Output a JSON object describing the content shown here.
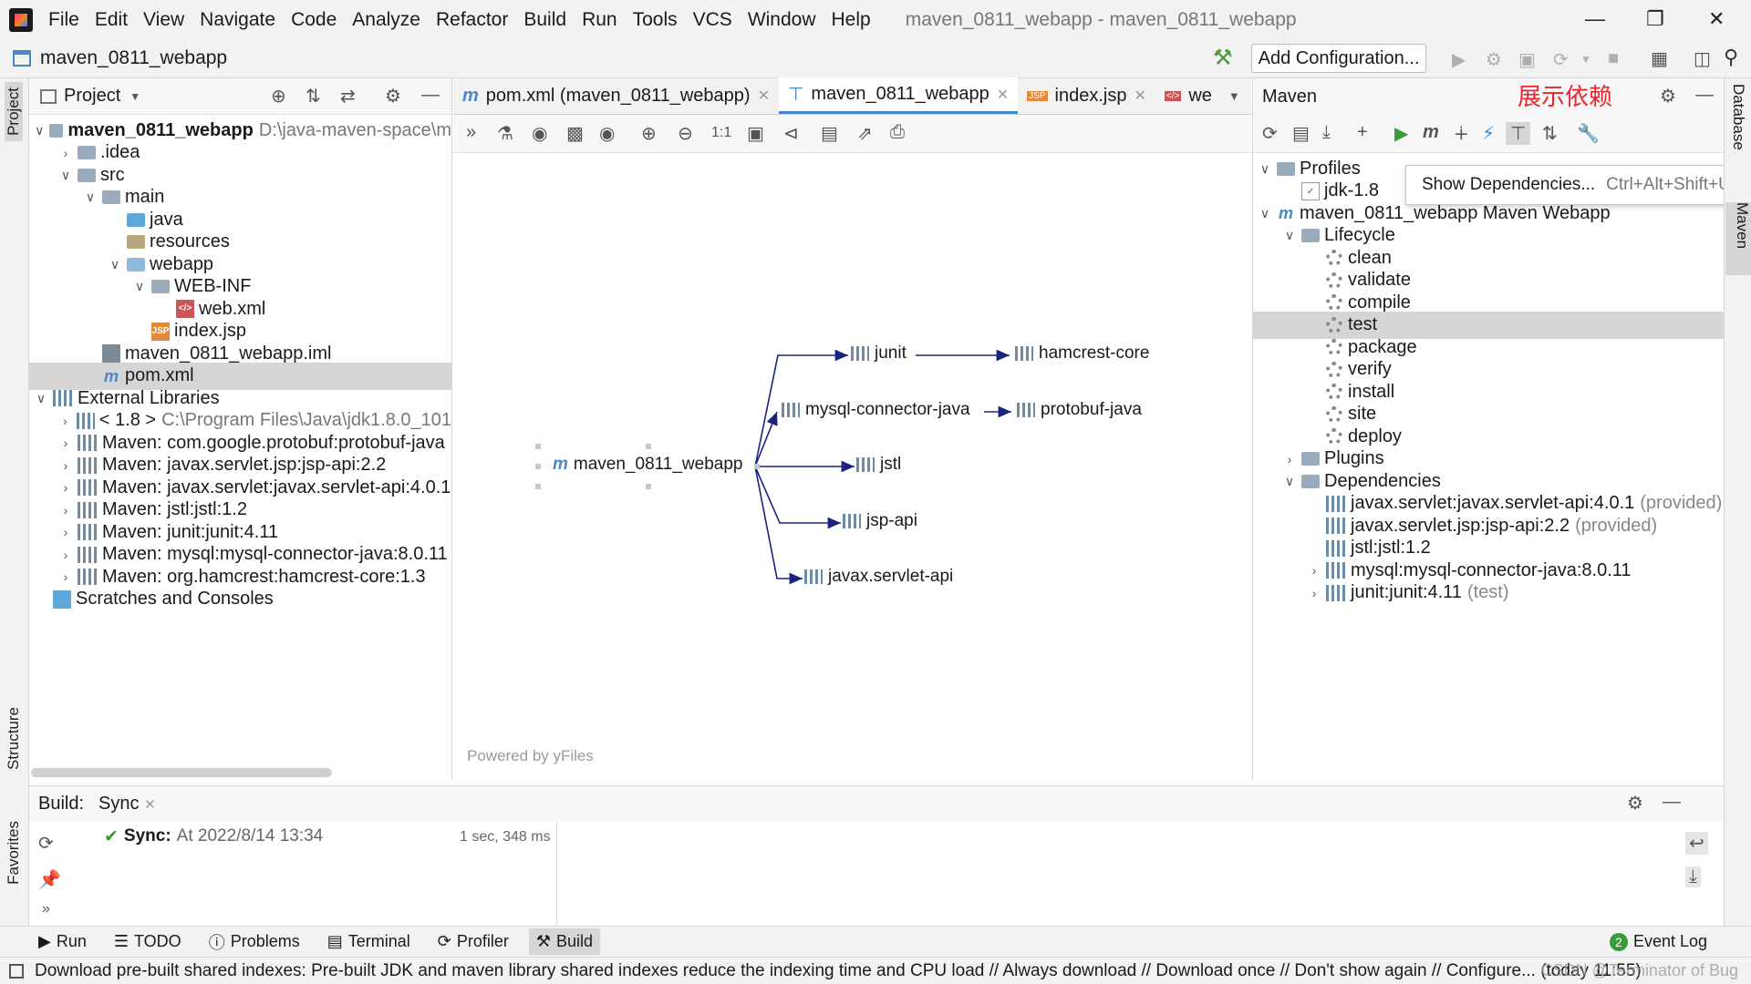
{
  "menu": {
    "items": [
      "File",
      "Edit",
      "View",
      "Navigate",
      "Code",
      "Analyze",
      "Refactor",
      "Build",
      "Run",
      "Tools",
      "VCS",
      "Window",
      "Help"
    ],
    "title": "maven_0811_webapp - maven_0811_webapp"
  },
  "nav": {
    "project": "maven_0811_webapp",
    "add_config": "Add Configuration..."
  },
  "stripe": {
    "project": "Project",
    "structure": "Structure",
    "favorites": "Favorites",
    "database": "Database",
    "maven": "Maven"
  },
  "project": {
    "title": "Project",
    "tree": [
      {
        "label": "maven_0811_webapp",
        "extra": "D:\\java-maven-space\\m",
        "level": 0,
        "arrow": "v",
        "icon": "module-folder",
        "bold": true
      },
      {
        "label": ".idea",
        "level": 1,
        "arrow": ">",
        "icon": "folder"
      },
      {
        "label": "src",
        "level": 1,
        "arrow": "v",
        "icon": "folder"
      },
      {
        "label": "main",
        "level": 2,
        "arrow": "v",
        "icon": "folder"
      },
      {
        "label": "java",
        "level": 3,
        "arrow": "",
        "icon": "source-folder"
      },
      {
        "label": "resources",
        "level": 3,
        "arrow": "",
        "icon": "resources-folder"
      },
      {
        "label": "webapp",
        "level": 3,
        "arrow": "v",
        "icon": "web-folder"
      },
      {
        "label": "WEB-INF",
        "level": 4,
        "arrow": "v",
        "icon": "folder"
      },
      {
        "label": "web.xml",
        "level": 5,
        "arrow": "",
        "icon": "xml-file"
      },
      {
        "label": "index.jsp",
        "level": 4,
        "arrow": "",
        "icon": "jsp-file"
      },
      {
        "label": "maven_0811_webapp.iml",
        "level": 2,
        "arrow": "",
        "icon": "iml-file"
      },
      {
        "label": "pom.xml",
        "level": 2,
        "arrow": "",
        "icon": "maven-file",
        "selected": true
      },
      {
        "label": "External Libraries",
        "level": 0,
        "arrow": "v",
        "icon": "library"
      },
      {
        "label": "< 1.8 >",
        "extra": "C:\\Program Files\\Java\\jdk1.8.0_101",
        "level": 1,
        "arrow": ">",
        "icon": "jdk"
      },
      {
        "label": "Maven: com.google.protobuf:protobuf-java",
        "level": 1,
        "arrow": ">",
        "icon": "library"
      },
      {
        "label": "Maven: javax.servlet.jsp:jsp-api:2.2",
        "level": 1,
        "arrow": ">",
        "icon": "library"
      },
      {
        "label": "Maven: javax.servlet:javax.servlet-api:4.0.1",
        "level": 1,
        "arrow": ">",
        "icon": "library"
      },
      {
        "label": "Maven: jstl:jstl:1.2",
        "level": 1,
        "arrow": ">",
        "icon": "library"
      },
      {
        "label": "Maven: junit:junit:4.11",
        "level": 1,
        "arrow": ">",
        "icon": "library"
      },
      {
        "label": "Maven: mysql:mysql-connector-java:8.0.11",
        "level": 1,
        "arrow": ">",
        "icon": "library"
      },
      {
        "label": "Maven: org.hamcrest:hamcrest-core:1.3",
        "level": 1,
        "arrow": ">",
        "icon": "library"
      },
      {
        "label": "Scratches and Consoles",
        "level": 0,
        "arrow": "",
        "icon": "scratches"
      }
    ]
  },
  "editor": {
    "tabs": [
      {
        "label": "pom.xml (maven_0811_webapp)",
        "icon": "maven-file"
      },
      {
        "label": "maven_0811_webapp",
        "icon": "diagram",
        "active": true
      },
      {
        "label": "index.jsp",
        "icon": "jsp-file"
      },
      {
        "label": "we",
        "icon": "xml-file"
      }
    ],
    "powered": "Powered by yFiles"
  },
  "graph": {
    "root": "maven_0811_webapp",
    "nodes": {
      "junit": "junit",
      "hamcrest": "hamcrest-core",
      "mysql": "mysql-connector-java",
      "protobuf": "protobuf-java",
      "jstl": "jstl",
      "jspapi": "jsp-api",
      "servlet": "javax.servlet-api"
    }
  },
  "maven": {
    "title": "Maven",
    "annotation": "展示依赖",
    "annotation_color": "#e8262c",
    "tree": [
      {
        "label": "Profiles",
        "level": 0,
        "arrow": "v",
        "icon": "folder"
      },
      {
        "label": "jdk-1.8",
        "level": 1,
        "arrow": "",
        "icon": "checkbox"
      },
      {
        "label": "maven_0811_webapp Maven Webapp",
        "level": 0,
        "arrow": "v",
        "icon": "maven-module"
      },
      {
        "label": "Lifecycle",
        "level": 1,
        "arrow": "v",
        "icon": "folder"
      },
      {
        "label": "clean",
        "level": 2,
        "arrow": "",
        "icon": "gear"
      },
      {
        "label": "validate",
        "level": 2,
        "arrow": "",
        "icon": "gear"
      },
      {
        "label": "compile",
        "level": 2,
        "arrow": "",
        "icon": "gear"
      },
      {
        "label": "test",
        "level": 2,
        "arrow": "",
        "icon": "gear",
        "selected": true
      },
      {
        "label": "package",
        "level": 2,
        "arrow": "",
        "icon": "gear"
      },
      {
        "label": "verify",
        "level": 2,
        "arrow": "",
        "icon": "gear"
      },
      {
        "label": "install",
        "level": 2,
        "arrow": "",
        "icon": "gear"
      },
      {
        "label": "site",
        "level": 2,
        "arrow": "",
        "icon": "gear"
      },
      {
        "label": "deploy",
        "level": 2,
        "arrow": "",
        "icon": "gear"
      },
      {
        "label": "Plugins",
        "level": 1,
        "arrow": ">",
        "icon": "folder"
      },
      {
        "label": "Dependencies",
        "level": 1,
        "arrow": "v",
        "icon": "folder"
      },
      {
        "label": "javax.servlet:javax.servlet-api:4.0.1",
        "scope": "(provided)",
        "level": 2,
        "arrow": "",
        "icon": "library"
      },
      {
        "label": "javax.servlet.jsp:jsp-api:2.2",
        "scope": "(provided)",
        "level": 2,
        "arrow": "",
        "icon": "library"
      },
      {
        "label": "jstl:jstl:1.2",
        "level": 2,
        "arrow": "",
        "icon": "library"
      },
      {
        "label": "mysql:mysql-connector-java:8.0.11",
        "level": 2,
        "arrow": ">",
        "icon": "library"
      },
      {
        "label": "junit:junit:4.11",
        "scope": "(test)",
        "level": 2,
        "arrow": ">",
        "icon": "library"
      }
    ]
  },
  "popup": {
    "label": "Show Dependencies...",
    "shortcut": "Ctrl+Alt+Shift+U"
  },
  "build": {
    "label": "Build:",
    "tab": "Sync",
    "sync_label": "Sync:",
    "sync_text": "At 2022/8/14 13:34",
    "duration": "1 sec, 348 ms"
  },
  "toolwindows": {
    "run": "Run",
    "todo": "TODO",
    "problems": "Problems",
    "terminal": "Terminal",
    "profiler": "Profiler",
    "build": "Build",
    "event_log": "Event Log",
    "event_count": "2"
  },
  "status": {
    "message": "Download pre-built shared indexes: Pre-built JDK and maven library shared indexes reduce the indexing time and CPU load // Always download // Download once // Don't show again // Configure... (today 11:55)",
    "watermark": "CSDN @Terminator of Bug"
  }
}
